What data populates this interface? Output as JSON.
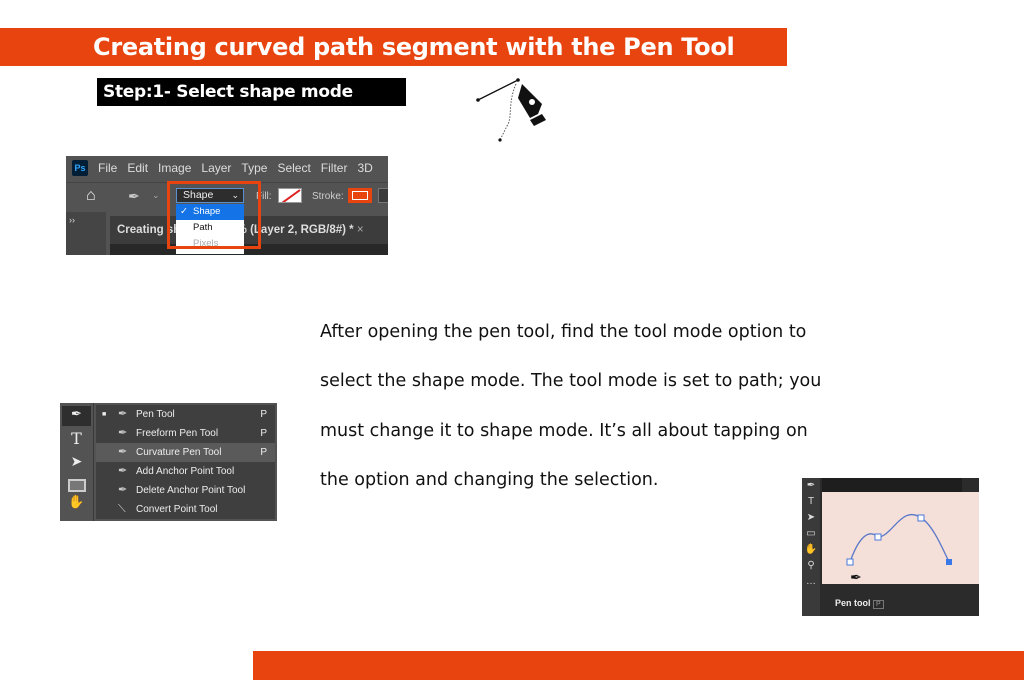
{
  "title": "Creating curved path segment with the Pen Tool",
  "step": "Step:1- Select shape mode",
  "body": [
    "After opening the pen tool, find the tool mode option to",
    "select the shape mode. The tool mode is set to path; you",
    "must change it to shape mode. It’s all about tapping on",
    "the option and changing the selection."
  ],
  "colors": {
    "accent": "#e8440f",
    "ps_bg": "#535353",
    "selection": "#1473e6",
    "canvas_pink": "#f5dfd9"
  },
  "ps_menu": {
    "logo": "Ps",
    "items": [
      "File",
      "Edit",
      "Image",
      "Layer",
      "Type",
      "Select",
      "Filter",
      "3D"
    ]
  },
  "ps_options": {
    "mode_value": "Shape",
    "mode_options": [
      "Shape",
      "Path",
      "Pixels"
    ],
    "fill_label": "Fill:",
    "stroke_label": "Stroke:",
    "doc_tab": "Creating sh",
    "doc_tab_rest": "6% (Layer 2, RGB/8#) *",
    "close": "×"
  },
  "flyout": [
    {
      "label": "Pen Tool",
      "key": "P"
    },
    {
      "label": "Freeform Pen Tool",
      "key": "P"
    },
    {
      "label": "Curvature Pen Tool",
      "key": "P"
    },
    {
      "label": "Add Anchor Point Tool",
      "key": ""
    },
    {
      "label": "Delete Anchor Point Tool",
      "key": ""
    },
    {
      "label": "Convert Point Tool",
      "key": ""
    }
  ],
  "tooltip": {
    "label": "Pen tool",
    "key": "P"
  }
}
